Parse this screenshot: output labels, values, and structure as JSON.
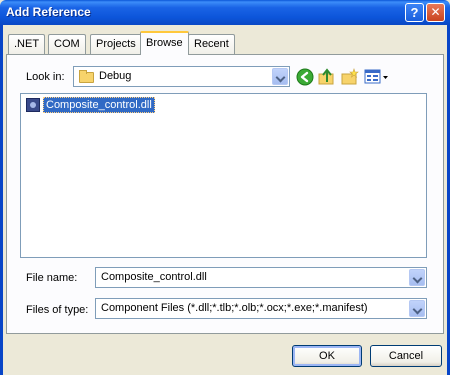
{
  "window": {
    "title": "Add Reference",
    "help_glyph": "?",
    "close_glyph": "✕"
  },
  "tabs": [
    {
      "label": ".NET"
    },
    {
      "label": "COM"
    },
    {
      "label": "Projects"
    },
    {
      "label": "Browse",
      "active": true
    },
    {
      "label": "Recent"
    }
  ],
  "look_in": {
    "label": "Look in:",
    "value": "Debug"
  },
  "toolbar_icons": [
    "back-icon",
    "up-folder-icon",
    "new-folder-icon",
    "view-menu-icon"
  ],
  "files": [
    {
      "name": "Composite_control.dll",
      "selected": true
    }
  ],
  "file_name": {
    "label": "File name:",
    "value": "Composite_control.dll"
  },
  "file_type": {
    "label": "Files of type:",
    "value": "Component Files (*.dll;*.tlb;*.olb;*.ocx;*.exe;*.manifest)"
  },
  "buttons": {
    "ok": "OK",
    "cancel": "Cancel"
  },
  "colors": {
    "titlebar": "#0A56D8",
    "selection": "#316AC5",
    "face": "#ECE9D8",
    "active_tab_accent": "#FFC83C"
  }
}
